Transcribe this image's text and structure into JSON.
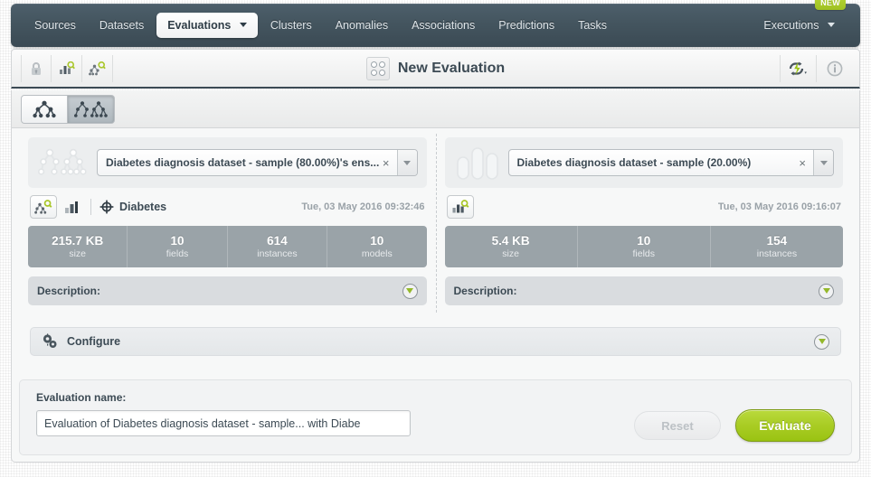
{
  "nav": {
    "items": [
      {
        "label": "Sources",
        "active": false,
        "caret": false
      },
      {
        "label": "Datasets",
        "active": false,
        "caret": false
      },
      {
        "label": "Evaluations",
        "active": true,
        "caret": true
      },
      {
        "label": "Clusters",
        "active": false,
        "caret": false
      },
      {
        "label": "Anomalies",
        "active": false,
        "caret": false
      },
      {
        "label": "Associations",
        "active": false,
        "caret": false
      },
      {
        "label": "Predictions",
        "active": false,
        "caret": false
      },
      {
        "label": "Tasks",
        "active": false,
        "caret": false
      }
    ],
    "executions_label": "Executions",
    "new_badge": "NEW"
  },
  "header": {
    "title": "New Evaluation",
    "left_icons": [
      "lock-icon",
      "dataset-search-icon",
      "model-search-icon"
    ],
    "right_icons": [
      "lightning-menu-icon",
      "info-icon"
    ]
  },
  "tabs": {
    "items": [
      {
        "name": "single-model-tab",
        "icon": "model-tree-icon",
        "active": false
      },
      {
        "name": "ensemble-tab",
        "icon": "ensemble-trees-icon",
        "active": true
      }
    ]
  },
  "left_panel": {
    "resource_icon": "ensemble-trees-icon",
    "select": {
      "value": "Diabetes diagnosis dataset - sample (80.00%)'s ens...",
      "clear": "×"
    },
    "meta": {
      "objective_name": "Diabetes",
      "date": "Tue, 03 May 2016 09:32:46"
    },
    "stats": [
      {
        "value": "215.7 KB",
        "label": "size"
      },
      {
        "value": "10",
        "label": "fields"
      },
      {
        "value": "614",
        "label": "instances"
      },
      {
        "value": "10",
        "label": "models"
      }
    ],
    "description_label": "Description:"
  },
  "right_panel": {
    "resource_icon": "dataset-bars-icon",
    "select": {
      "value": "Diabetes diagnosis dataset - sample (20.00%)",
      "clear": "×"
    },
    "meta": {
      "objective_name": "",
      "date": "Tue, 03 May 2016 09:16:07"
    },
    "stats": [
      {
        "value": "5.4 KB",
        "label": "size"
      },
      {
        "value": "10",
        "label": "fields"
      },
      {
        "value": "154",
        "label": "instances"
      }
    ],
    "description_label": "Description:"
  },
  "configure": {
    "label": "Configure"
  },
  "form": {
    "name_label": "Evaluation name:",
    "name_value": "Evaluation of Diabetes diagnosis dataset - sample... with Diabe",
    "name_placeholder": "Evaluation name",
    "reset_label": "Reset",
    "evaluate_label": "Evaluate"
  },
  "colors": {
    "nav_bg": "#44555f",
    "accent_green": "#a9cc24",
    "stat_bar": "#9aa3a8",
    "text_dark": "#3c4a54",
    "page_bg": "#f7f8f8"
  }
}
